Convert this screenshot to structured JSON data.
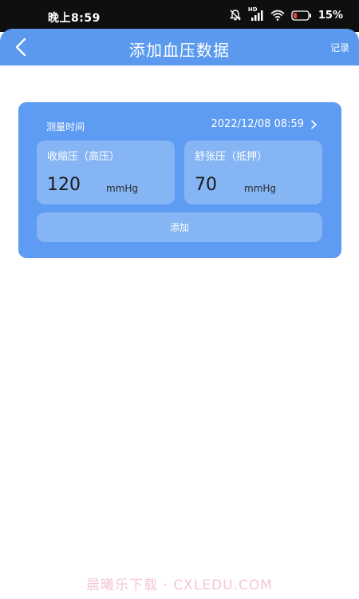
{
  "status_bar": {
    "time": "晚上8:59",
    "signal_label": "HD",
    "battery": "15%",
    "icons": [
      "bell-muted-icon",
      "cellular-signal-icon",
      "wifi-icon",
      "battery-icon"
    ]
  },
  "header": {
    "title": "添加血压数据",
    "record_label": "记录",
    "back_icon": "chevron-left-icon"
  },
  "form": {
    "time_label": "测量时间",
    "time_value": "2022/12/08 08:59",
    "systolic": {
      "label": "收缩压（高压）",
      "value": "120",
      "unit": "mmHg"
    },
    "diastolic": {
      "label": "舒张压（抵押）",
      "value": "70",
      "unit": "mmHg"
    },
    "add_label": "添加"
  },
  "watermark": "晨曦乐下载 · CXLEDU.COM",
  "colors": {
    "header": "#5a99ee",
    "card": "#5d9cf2",
    "panel": "#85b5f4",
    "status_bar": "#0f0f10"
  }
}
